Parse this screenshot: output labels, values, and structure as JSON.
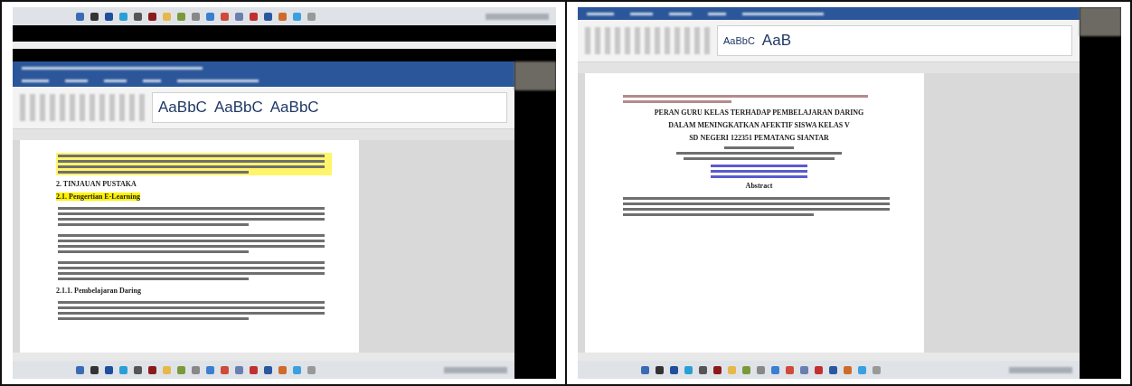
{
  "panels": [
    {
      "top_taskbar": true,
      "ribbon_styles": [
        "AaBbC",
        "AaBbC",
        "AaBbC"
      ],
      "document": [
        {
          "kind": "paragraph",
          "highlighted": true
        },
        {
          "kind": "heading",
          "text": "2. TINJAUAN PUSTAKA",
          "highlighted": false
        },
        {
          "kind": "heading",
          "text": "2.1. Pengertian E-Learning",
          "highlighted": true
        },
        {
          "kind": "paragraph",
          "highlighted": false
        },
        {
          "kind": "paragraph",
          "highlighted": false
        },
        {
          "kind": "paragraph",
          "highlighted": false
        },
        {
          "kind": "heading",
          "text": "2.1.1. Pembelajaran Daring",
          "highlighted": false
        },
        {
          "kind": "paragraph",
          "highlighted": false
        }
      ]
    },
    {
      "top_taskbar": false,
      "ribbon_styles": [
        "AaBbC",
        "AaB"
      ],
      "document": [
        {
          "kind": "note"
        },
        {
          "kind": "title",
          "text": "PERAN GURU KELAS TERHADAP PEMBELAJARAN DARING"
        },
        {
          "kind": "title",
          "text": "DALAM MENINGKATKAN AFEKTIF SISWA KELAS V"
        },
        {
          "kind": "title",
          "text": "SD NEGERI 122351 PEMATANG SIANTAR"
        },
        {
          "kind": "affiliation"
        },
        {
          "kind": "links"
        },
        {
          "kind": "title",
          "text": "Abstract"
        },
        {
          "kind": "paragraph",
          "highlighted": false
        }
      ]
    }
  ]
}
